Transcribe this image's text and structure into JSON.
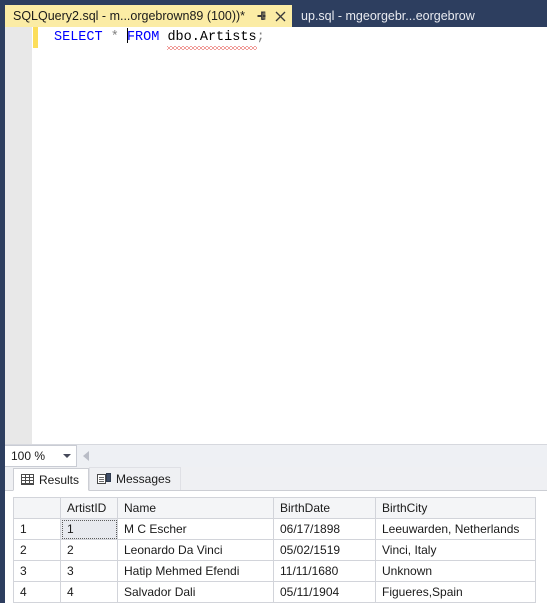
{
  "window": {
    "accent_dark": "#2d3e5f",
    "active_tab_bg": "#fbeca5"
  },
  "tabs": [
    {
      "label": "SQLQuery2.sql - m...orgebrown89 (100))*",
      "active": true,
      "pin_icon": "pin-icon",
      "close_icon": "close-icon"
    },
    {
      "label": "up.sql - mgeorgebr...eorgebrow",
      "active": false
    }
  ],
  "editor": {
    "code_tokens": {
      "select": "SELECT",
      "star": "*",
      "from": "FROM",
      "table": "dbo.Artists",
      "semicolon": ";"
    },
    "has_error_squiggle": true
  },
  "zoombar": {
    "zoom_level": "100 %",
    "dropdown_icon": "chevron-down-icon",
    "scroll_left_icon": "scroll-left-arrow-icon"
  },
  "result_tabs": [
    {
      "label": "Results",
      "icon": "grid-icon",
      "active": true
    },
    {
      "label": "Messages",
      "icon": "document-icon",
      "active": false
    }
  ],
  "grid": {
    "columns": [
      "ArtistID",
      "Name",
      "BirthDate",
      "BirthCity"
    ],
    "row_numbers": [
      "1",
      "2",
      "3",
      "4"
    ],
    "rows": [
      {
        "ArtistID": "1",
        "Name": "M C Escher",
        "BirthDate": "06/17/1898",
        "BirthCity": "Leeuwarden, Netherlands"
      },
      {
        "ArtistID": "2",
        "Name": "Leonardo Da Vinci",
        "BirthDate": "05/02/1519",
        "BirthCity": "Vinci, Italy"
      },
      {
        "ArtistID": "3",
        "Name": "Hatip Mehmed Efendi",
        "BirthDate": "11/11/1680",
        "BirthCity": "Unknown"
      },
      {
        "ArtistID": "4",
        "Name": "Salvador Dali",
        "BirthDate": "05/11/1904",
        "BirthCity": "Figueres,Spain"
      }
    ],
    "focused_cell": {
      "row": 0,
      "column": "ArtistID"
    }
  }
}
